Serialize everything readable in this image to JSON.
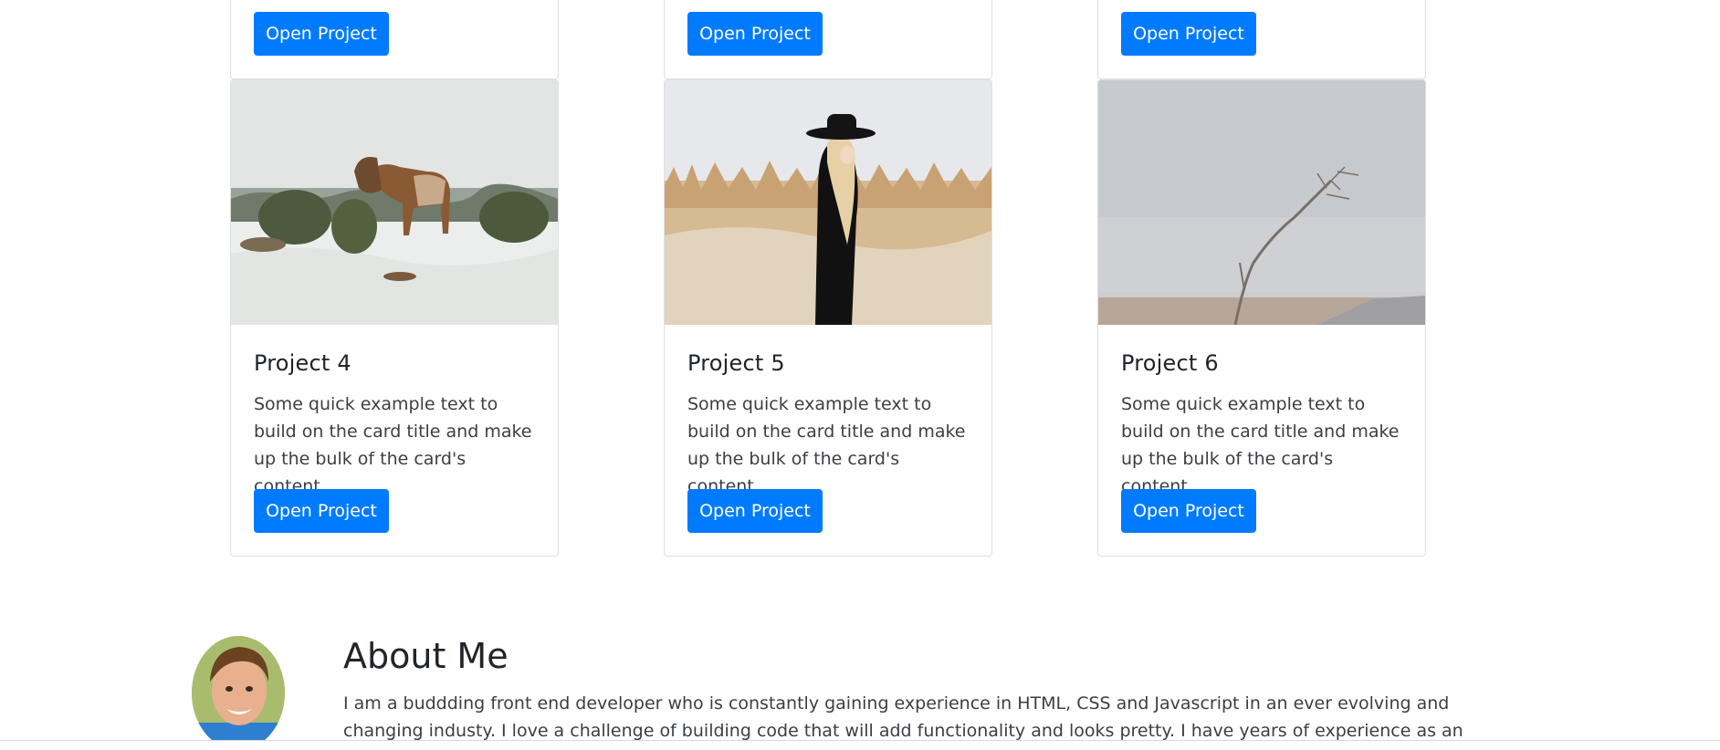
{
  "top_cards": [
    {
      "button_label": "Open Project"
    },
    {
      "button_label": "Open Project"
    },
    {
      "button_label": "Open Project"
    }
  ],
  "cards": [
    {
      "title": "Project 4",
      "text": "Some quick example text to build on the card title and make up the bulk of the card's content.",
      "button_label": "Open Project",
      "image": "horse-in-snow"
    },
    {
      "title": "Project 5",
      "text": "Some quick example text to build on the card title and make up the bulk of the card's content.",
      "button_label": "Open Project",
      "image": "woman-in-hat-in-field"
    },
    {
      "title": "Project 6",
      "text": "Some quick example text to build on the card title and make up the bulk of the card's content.",
      "button_label": "Open Project",
      "image": "bare-branch-landscape"
    }
  ],
  "about": {
    "title": "About Me",
    "text": "I am a buddding front end developer who is constantly gaining experience in HTML, CSS and Javascript in an ever evolving and changing industy. I love a challenge of building code that will add functionality and looks pretty. I have years of experience as an Accountant so I am meticulous in my"
  },
  "colors": {
    "primary": "#007bff",
    "border": "#dfe0e2",
    "text": "#212529"
  }
}
